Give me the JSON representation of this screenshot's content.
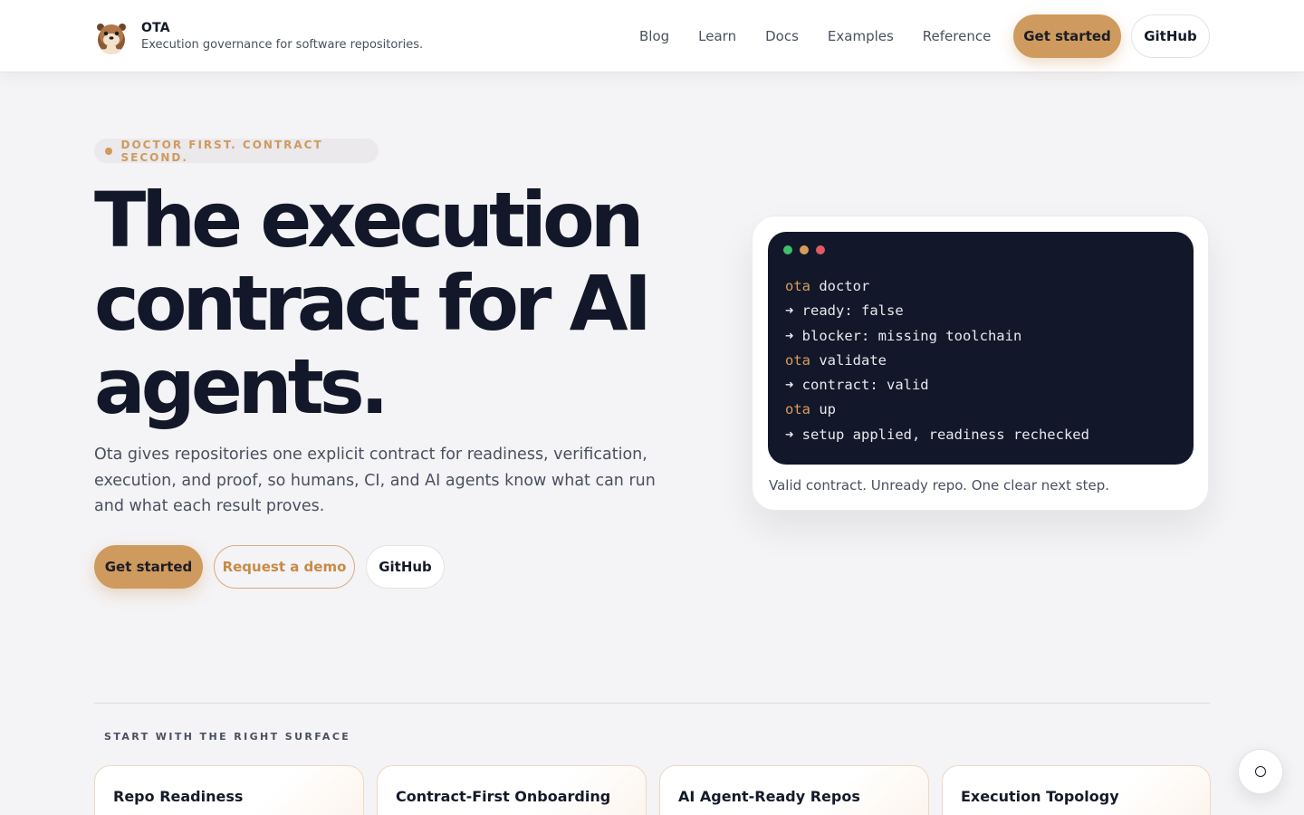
{
  "header": {
    "brand_name": "OTA",
    "brand_tagline": "Execution governance for software repositories.",
    "nav": [
      "Blog",
      "Learn",
      "Docs",
      "Examples",
      "Reference"
    ],
    "get_started_label": "Get started",
    "github_label": "GitHub"
  },
  "hero": {
    "eyebrow": "DOCTOR FIRST. CONTRACT SECOND.",
    "title_line1": "The execution",
    "title_line2": "contract for AI",
    "title_line3": "agents.",
    "description": "Ota gives repositories one explicit contract for readiness, verification, execution, and proof, so humans, CI, and AI agents know what can run and what each result proves.",
    "get_started_label": "Get started",
    "demo_label": "Request a demo",
    "github_label": "GitHub"
  },
  "terminal": {
    "dot_colors": [
      "#3fbf6a",
      "#d99b5d",
      "#e05a63"
    ],
    "lines": [
      {
        "prefix": "ota",
        "text": " doctor"
      },
      {
        "prefix": "",
        "text": "➜ ready: false"
      },
      {
        "prefix": "",
        "text": "➜ blocker: missing toolchain"
      },
      {
        "prefix": "ota",
        "text": " validate"
      },
      {
        "prefix": "",
        "text": "➜ contract: valid"
      },
      {
        "prefix": "ota",
        "text": " up"
      },
      {
        "prefix": "",
        "text": "➜ setup applied, readiness rechecked"
      }
    ],
    "caption": "Valid contract. Unready repo. One clear next step."
  },
  "surfaces": {
    "label": "START WITH THE RIGHT SURFACE",
    "cards": [
      "Repo Readiness",
      "Contract-First Onboarding",
      "AI Agent-Ready Repos",
      "Execution Topology"
    ]
  },
  "colors": {
    "accent": "#cf9a5e",
    "ink": "#121829",
    "background": "#f4f3f5"
  }
}
